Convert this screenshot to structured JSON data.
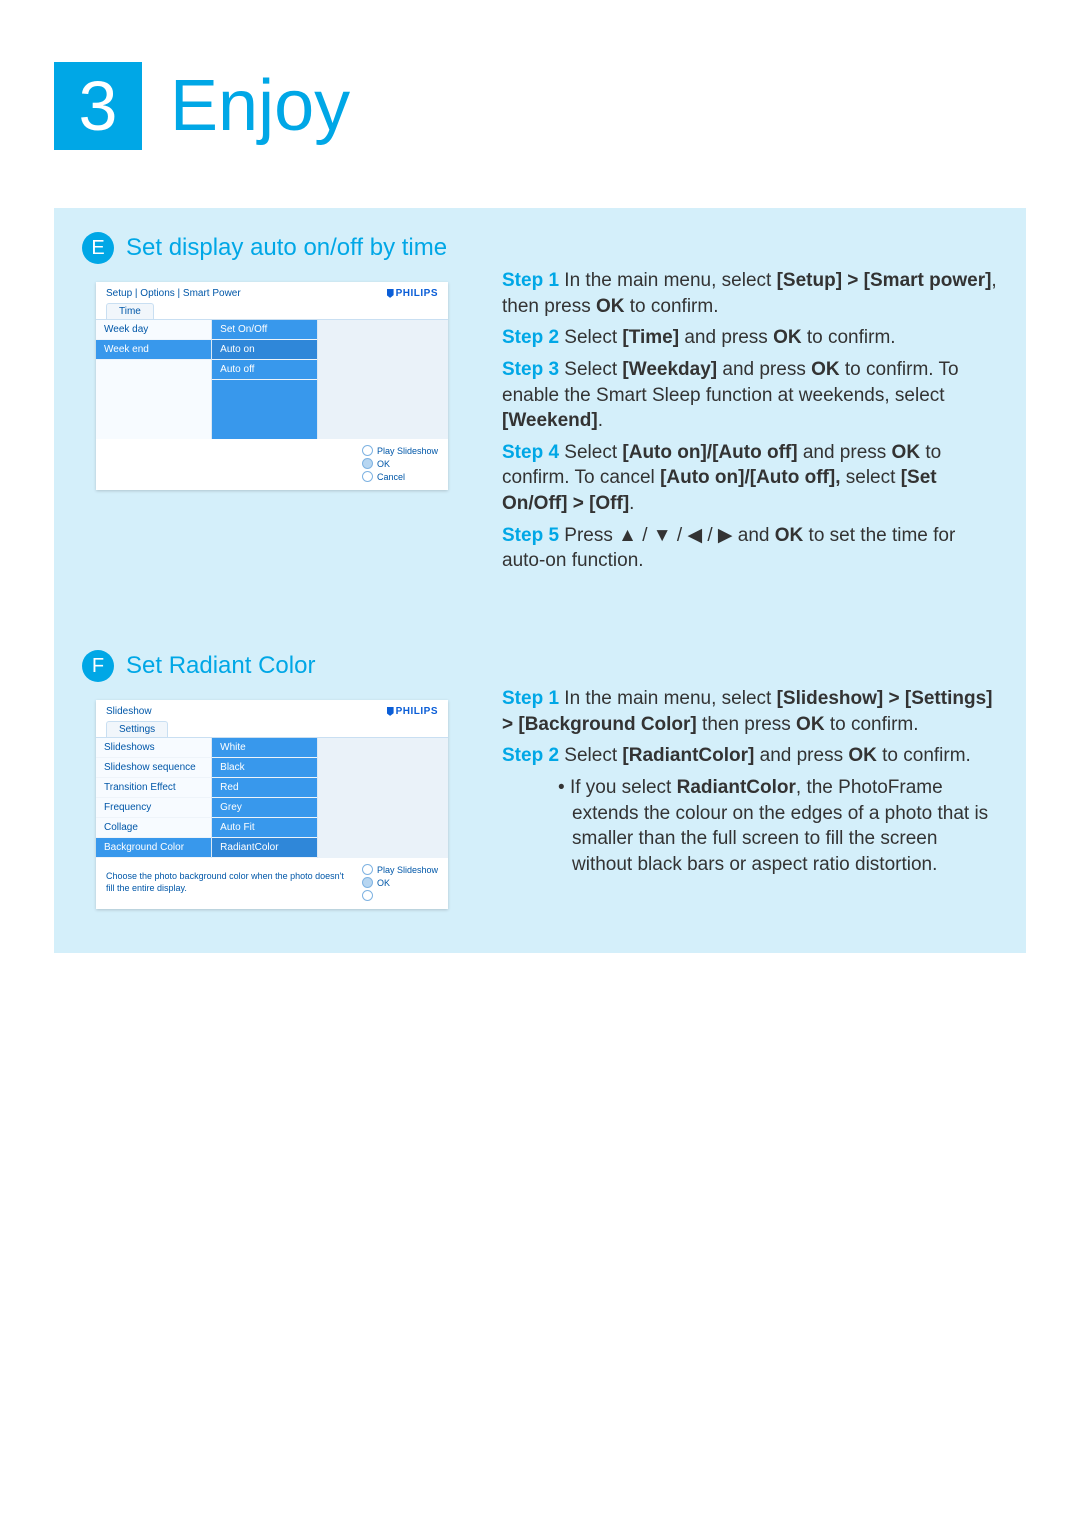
{
  "chapter": {
    "number": "3",
    "title": "Enjoy"
  },
  "sectionE": {
    "badge": "E",
    "title": "Set display auto on/off by time",
    "screen": {
      "breadcrumb": "Setup | Options | Smart Power",
      "brand": "PHILIPS",
      "tab": "Time",
      "colA": [
        "Week day",
        "Week end"
      ],
      "colB": [
        "Set On/Off",
        "Auto on",
        "Auto off"
      ],
      "footer_actions": [
        "Play Slideshow",
        "OK",
        "Cancel"
      ]
    },
    "steps": {
      "s1_label": "Step 1",
      "s1_a": " In the main menu, select ",
      "s1_b1": "[Setup] > [Smart power]",
      "s1_c": ", then press ",
      "s1_b2": "OK",
      "s1_d": " to confirm.",
      "s2_label": "Step 2",
      "s2_a": " Select ",
      "s2_b1": "[Time]",
      "s2_c": " and press ",
      "s2_b2": "OK",
      "s2_d": " to confirm.",
      "s3_label": "Step 3",
      "s3_a": " Select ",
      "s3_b1": "[Weekday]",
      "s3_c": " and press ",
      "s3_b2": "OK",
      "s3_d": " to confirm. To enable the Smart Sleep function at weekends, select ",
      "s3_b3": "[Weekend]",
      "s3_e": ".",
      "s4_label": "Step 4",
      "s4_a": " Select ",
      "s4_b1": "[Auto on]/[Auto off]",
      "s4_c": " and press ",
      "s4_b2": "OK",
      "s4_d": " to confirm. To cancel ",
      "s4_b3": "[Auto on]/[Auto off],",
      "s4_e": " select ",
      "s4_b4": "[Set On/Off] > [Off]",
      "s4_f": ".",
      "s5_label": "Step 5",
      "s5_a": " Press ",
      "s5_arrows": "▲ / ▼ / ◀ / ▶",
      "s5_b": " and ",
      "s5_ok": "OK",
      "s5_c": " to set the time for auto-on function."
    }
  },
  "sectionF": {
    "badge": "F",
    "title": "Set Radiant Color",
    "screen": {
      "breadcrumb": "Slideshow",
      "brand": "PHILIPS",
      "tab": "Settings",
      "colA": [
        "Slideshows",
        "Slideshow sequence",
        "Transition Effect",
        "Frequency",
        "Collage",
        "Background Color"
      ],
      "colB": [
        "White",
        "Black",
        "Red",
        "Grey",
        "Auto Fit",
        "RadiantColor"
      ],
      "footer_hint": "Choose the photo background color when the photo doesn't fill the entire display.",
      "footer_actions": [
        "Play Slideshow",
        "OK"
      ]
    },
    "steps": {
      "s1_label": "Step 1",
      "s1_a": " In the main menu, select ",
      "s1_b1": "[Slideshow] > [Settings] > [Background Color]",
      "s1_c": " then press ",
      "s1_b2": "OK",
      "s1_d": " to confirm.",
      "s2_label": "Step 2",
      "s2_a": " Select ",
      "s2_b1": "[RadiantColor]",
      "s2_c": " and press ",
      "s2_b2": "OK",
      "s2_d": " to confirm.",
      "note_a": "If you select ",
      "note_b": "RadiantColor",
      "note_c": ", the PhotoFrame extends the colour on the edges of a photo that is smaller than the full screen to fill the screen without black bars or aspect ratio distortion."
    }
  }
}
